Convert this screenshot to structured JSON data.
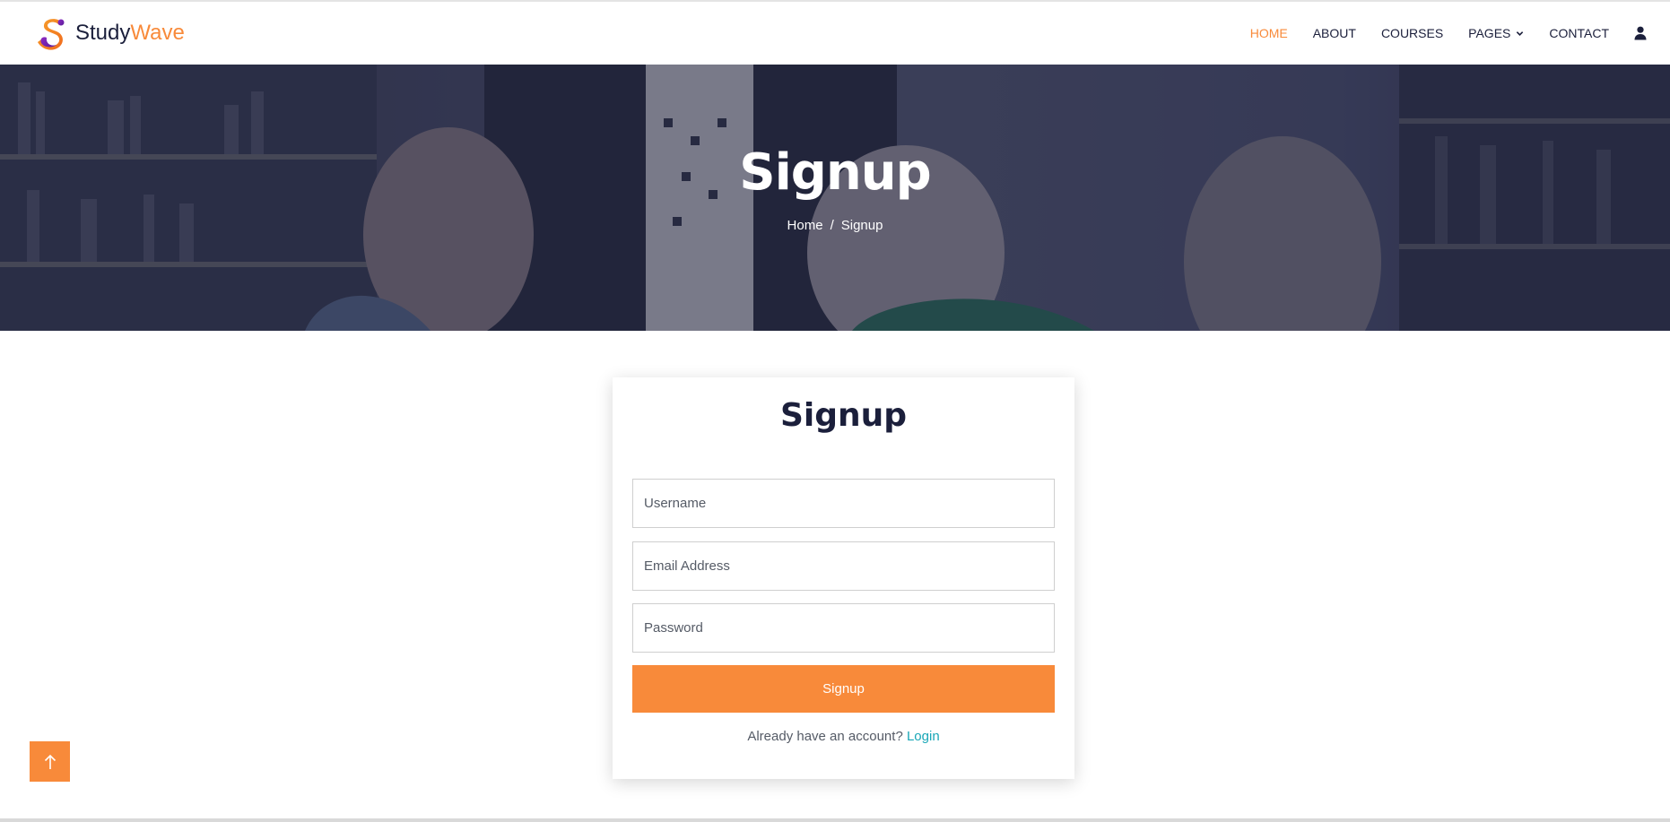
{
  "brand": {
    "study": "Study",
    "wave": "Wave"
  },
  "nav": {
    "items": [
      {
        "label": "HOME",
        "active": true
      },
      {
        "label": "ABOUT",
        "active": false
      },
      {
        "label": "COURSES",
        "active": false
      },
      {
        "label": "PAGES",
        "active": false,
        "dropdown": true
      },
      {
        "label": "CONTACT",
        "active": false
      }
    ],
    "user_icon": "user-icon"
  },
  "hero": {
    "title": "Signup",
    "breadcrumb": {
      "home": "Home",
      "separator": "/",
      "current": "Signup"
    }
  },
  "form": {
    "title": "Signup",
    "username_placeholder": "Username",
    "email_placeholder": "Email Address",
    "password_placeholder": "Password",
    "submit_label": "Signup",
    "switch_text": "Already have an account?",
    "login_link": "Login"
  },
  "back_to_top_icon": "arrow-up-icon",
  "colors": {
    "accent": "#f88a3a",
    "dark": "#1b1f3b",
    "link": "#19a7b7"
  }
}
